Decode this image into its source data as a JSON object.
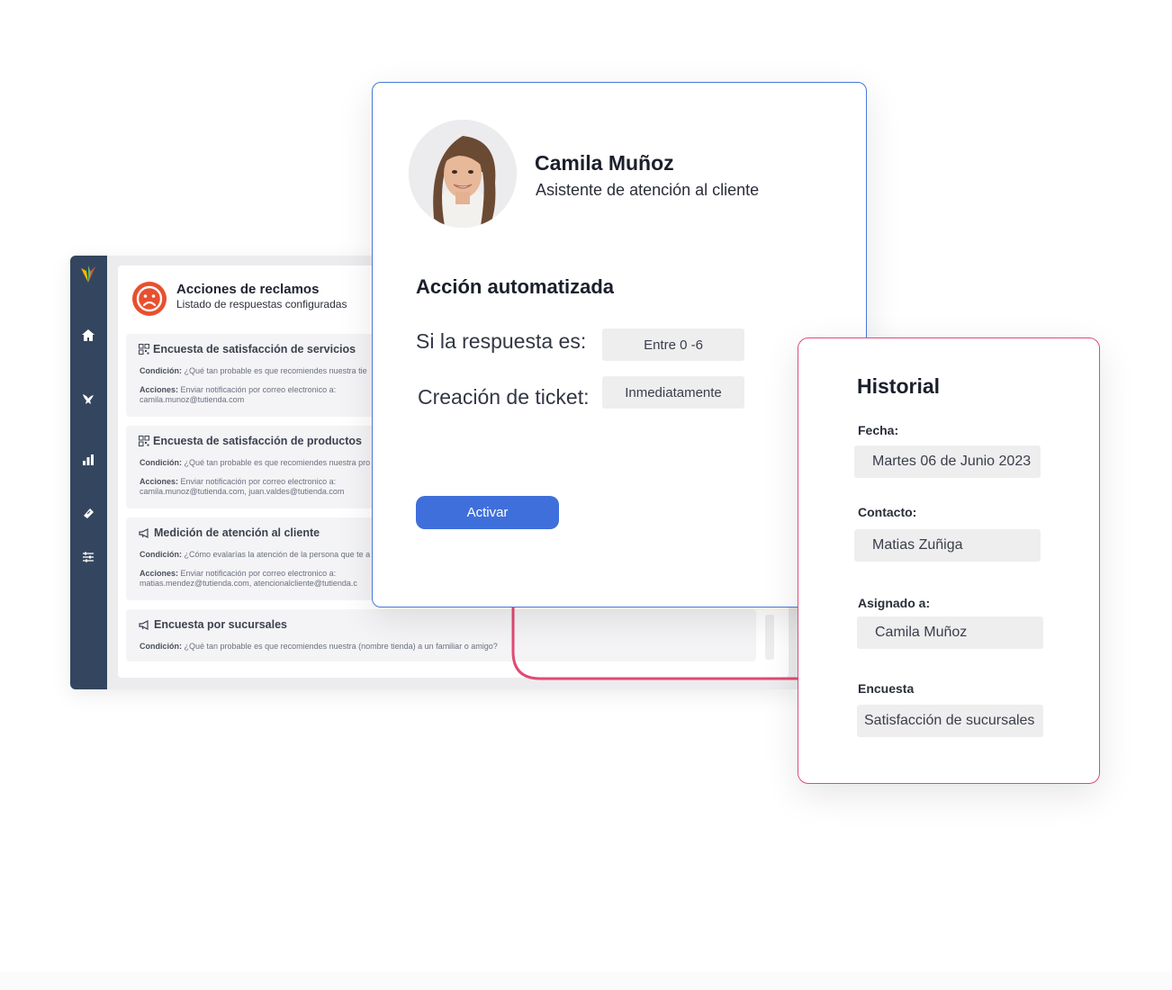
{
  "app": {
    "panel_title": "Acciones de reclamos",
    "panel_subtitle": "Listado de respuestas configuradas",
    "sidebar_icons": [
      "logo-icon",
      "home-icon",
      "bird-icon",
      "bar-chart-icon",
      "ticket-icon",
      "sliders-icon"
    ],
    "cards": [
      {
        "icon": "qr-icon",
        "title": "Encuesta de satisfacción de servicios",
        "condition_label": "Condición:",
        "condition": "¿Qué tan probable es que recomiendes nuestra tie",
        "actions_label": "Acciones:",
        "actions": "Enviar notificación por correo electronico a:",
        "emails": "camila.munoz@tutienda.com"
      },
      {
        "icon": "qr-icon",
        "title": "Encuesta de satisfacción de productos",
        "condition_label": "Condición:",
        "condition": "¿Qué tan probable es que recomiendes nuestra pro",
        "actions_label": "Acciones:",
        "actions": "Enviar notificación por correo electronico a:",
        "emails": "camila.munoz@tutienda.com, juan.valdes@tutienda.com"
      },
      {
        "icon": "megaphone-icon",
        "title": "Medición de atención al cliente",
        "condition_label": "Condición:",
        "condition": "¿Cómo evalarías la atención de la persona que te a",
        "actions_label": "Acciones:",
        "actions": "Enviar notificación por correo electronico a:",
        "emails": "matias.mendez@tutienda.com, atencionalcliente@tutienda.c"
      },
      {
        "icon": "megaphone-icon",
        "title": "Encuesta por sucursales",
        "condition_label": "Condición:",
        "condition": "¿Qué tan probable es que recomiendes nuestra (nombre tienda) a un familiar o amigo?"
      }
    ]
  },
  "main": {
    "name": "Camila Muñoz",
    "role": "Asistente de atención al cliente",
    "section_title": "Acción automatizada",
    "rows": [
      {
        "label": "Si la respuesta es:",
        "value": "Entre 0 -6"
      },
      {
        "label": "Creación de ticket:",
        "value": "Inmediatamente"
      }
    ],
    "button_label": "Activar"
  },
  "history": {
    "title": "Historial",
    "fields": [
      {
        "label": "Fecha:",
        "value": "Martes 06 de Junio 2023"
      },
      {
        "label": "Contacto:",
        "value": "Matias Zuñiga"
      },
      {
        "label": "Asignado a:",
        "value": "Camila Muñoz"
      },
      {
        "label": "Encuesta",
        "value": "Satisfacción de sucursales"
      }
    ]
  },
  "colors": {
    "accent_blue": "#3f6fdb",
    "accent_pink": "#e04a74",
    "sidebar": "#34465f",
    "sad_face": "#e8502f"
  }
}
